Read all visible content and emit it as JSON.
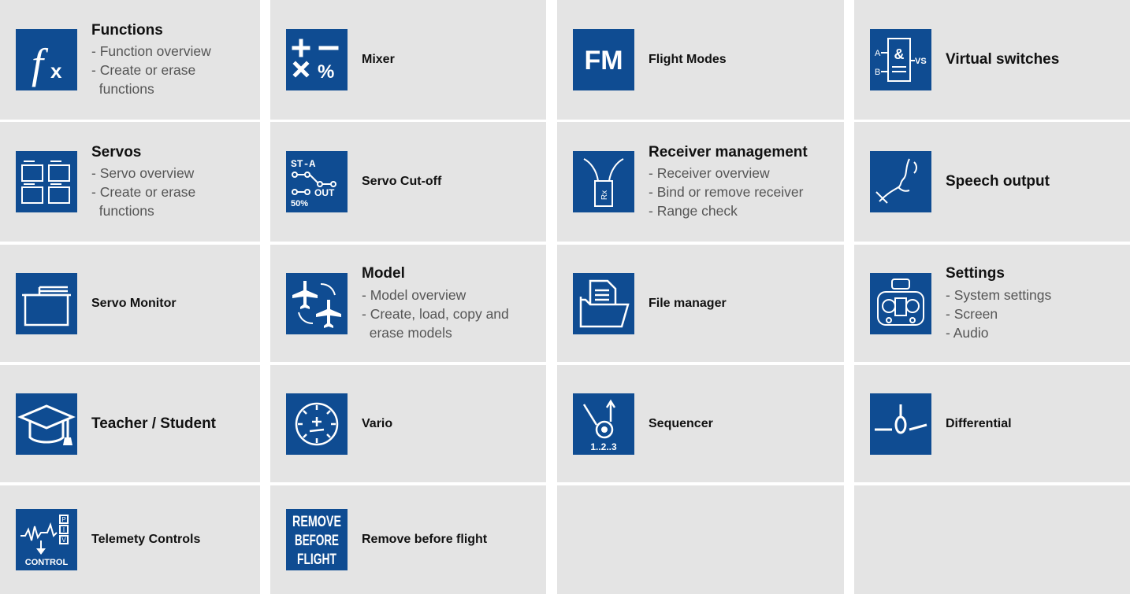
{
  "accent_color": "#0f4c92",
  "tile_color": "#e4e4e4",
  "tiles": [
    {
      "icon": "function-fx-icon",
      "title": "Functions",
      "lines": [
        "- Function overview",
        "- Create or erase",
        "  functions"
      ]
    },
    {
      "icon": "mixer-icon",
      "title": "Mixer",
      "lines": []
    },
    {
      "icon": "flight-modes-icon",
      "icon_text": "FM",
      "title": "Flight Modes",
      "lines": []
    },
    {
      "icon": "virtual-switches-icon",
      "icon_text": [
        "A",
        "&",
        "B",
        "VS"
      ],
      "title": "Virtual switches",
      "lines": []
    },
    {
      "icon": "servos-icon",
      "title": "Servos",
      "lines": [
        "- Servo overview",
        "- Create or erase",
        "  functions"
      ]
    },
    {
      "icon": "servo-cutoff-icon",
      "icon_text": [
        "ST-A",
        "OUT",
        "50%"
      ],
      "title": "Servo Cut-off",
      "lines": []
    },
    {
      "icon": "receiver-icon",
      "icon_text": "Rx",
      "title": "Receiver management",
      "lines": [
        "- Receiver overview",
        "- Bind or remove receiver",
        "- Range check"
      ]
    },
    {
      "icon": "speech-output-icon",
      "title": "Speech output",
      "lines": []
    },
    {
      "icon": "servo-monitor-icon",
      "title": "Servo Monitor",
      "lines": []
    },
    {
      "icon": "model-icon",
      "title": "Model",
      "lines": [
        "- Model overview",
        "- Create, load, copy and",
        "  erase models"
      ]
    },
    {
      "icon": "file-manager-icon",
      "title": "File manager",
      "lines": []
    },
    {
      "icon": "settings-transmitter-icon",
      "title": "Settings",
      "lines": [
        "- System settings",
        "- Screen",
        "- Audio"
      ]
    },
    {
      "icon": "graduation-cap-icon",
      "title": "Teacher / Student",
      "lines": []
    },
    {
      "icon": "vario-icon",
      "title": "Vario",
      "lines": []
    },
    {
      "icon": "sequencer-icon",
      "icon_text": "1..2..3",
      "title": "Sequencer",
      "lines": []
    },
    {
      "icon": "differential-icon",
      "title": "Differential",
      "lines": []
    },
    {
      "icon": "telemetry-controls-icon",
      "icon_text": [
        "P",
        "I",
        "V",
        "CONTROL"
      ],
      "title": "Telemety Controls",
      "lines": []
    },
    {
      "icon": "remove-before-flight-icon",
      "icon_text": [
        "REMOVE",
        "BEFORE",
        "FLIGHT"
      ],
      "title": "Remove before flight",
      "lines": []
    },
    {
      "icon": "",
      "title": "",
      "lines": []
    },
    {
      "icon": "",
      "title": "",
      "lines": []
    }
  ]
}
